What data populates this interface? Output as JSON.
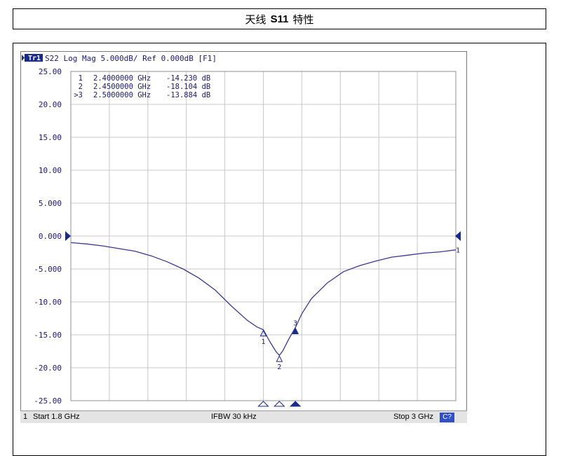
{
  "page_title": {
    "prefix": "天线",
    "bold": "S11",
    "suffix": "特性"
  },
  "trace_header": {
    "tag": "Tr1",
    "text": "S22 Log Mag 5.000dB/ Ref 0.000dB [F1]"
  },
  "markers": [
    {
      "label": "1",
      "freq": "2.4000000 GHz",
      "value": "-14.230 dB",
      "active": false
    },
    {
      "label": "2",
      "freq": "2.4500000 GHz",
      "value": "-18.104 dB",
      "active": false
    },
    {
      "label": ">3",
      "freq": "2.5000000 GHz",
      "value": "-13.884 dB",
      "active": true
    }
  ],
  "status_bar": {
    "channel": "1",
    "start": "Start 1.8 GHz",
    "ifbw": "IFBW 30 kHz",
    "stop": "Stop 3 GHz",
    "badge": "C?"
  },
  "colors": {
    "trace": "#3a3a8c",
    "grid": "#c8c8c8",
    "marker_active": "#1a2a8a",
    "text": "#1a1a6e"
  },
  "chart_data": {
    "type": "line",
    "x_unit": "GHz",
    "ylim": [
      -25,
      25
    ],
    "xlim": [
      1.8,
      3.0
    ],
    "y_ticks": [
      "25.00",
      "20.00",
      "15.00",
      "10.00",
      "5.000",
      "0.000",
      "-5.000",
      "-10.00",
      "-15.00",
      "-20.00",
      "-25.00"
    ],
    "grid": true,
    "series": [
      {
        "x": [
          1.8,
          1.85,
          1.9,
          1.95,
          2.0,
          2.05,
          2.1,
          2.15,
          2.2,
          2.25,
          2.3,
          2.35,
          2.38,
          2.4,
          2.42,
          2.44,
          2.45,
          2.46,
          2.48,
          2.5,
          2.52,
          2.55,
          2.6,
          2.65,
          2.7,
          2.75,
          2.8,
          2.85,
          2.9,
          2.95,
          3.0
        ],
        "y": [
          -1.0,
          -1.2,
          -1.5,
          -1.9,
          -2.3,
          -3.0,
          -3.9,
          -5.0,
          -6.4,
          -8.2,
          -10.6,
          -12.8,
          -13.8,
          -14.23,
          -16.0,
          -17.6,
          -18.104,
          -17.5,
          -15.6,
          -13.884,
          -11.8,
          -9.5,
          -7.1,
          -5.4,
          -4.5,
          -3.8,
          -3.2,
          -2.9,
          -2.6,
          -2.4,
          -2.1
        ]
      }
    ],
    "marker_points": [
      {
        "label": "1",
        "x": 2.4,
        "y": -14.23
      },
      {
        "label": "2",
        "x": 2.45,
        "y": -18.104
      },
      {
        "label": "3",
        "x": 2.5,
        "y": -13.884
      }
    ],
    "ref_level": 0.0,
    "ref_label": "1"
  }
}
